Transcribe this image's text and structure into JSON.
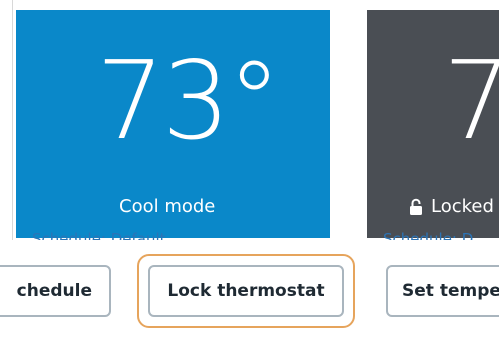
{
  "cards": [
    {
      "temperature": "73°",
      "mode_label": "Cool mode",
      "schedule_label": "Schedule: Default",
      "color": "#0a88c9"
    },
    {
      "temperature": "7",
      "mode_label": "Locked",
      "schedule_label": "Schedule: D",
      "icon": "lock-icon",
      "color": "#4a4e54"
    }
  ],
  "actions": {
    "schedule_label": "chedule",
    "lock_label": "Lock thermostat",
    "set_temp_label": "Set tempe"
  },
  "colors": {
    "focus": "#e6a45c",
    "border": "#a9b5be",
    "link": "#2c74b6"
  }
}
